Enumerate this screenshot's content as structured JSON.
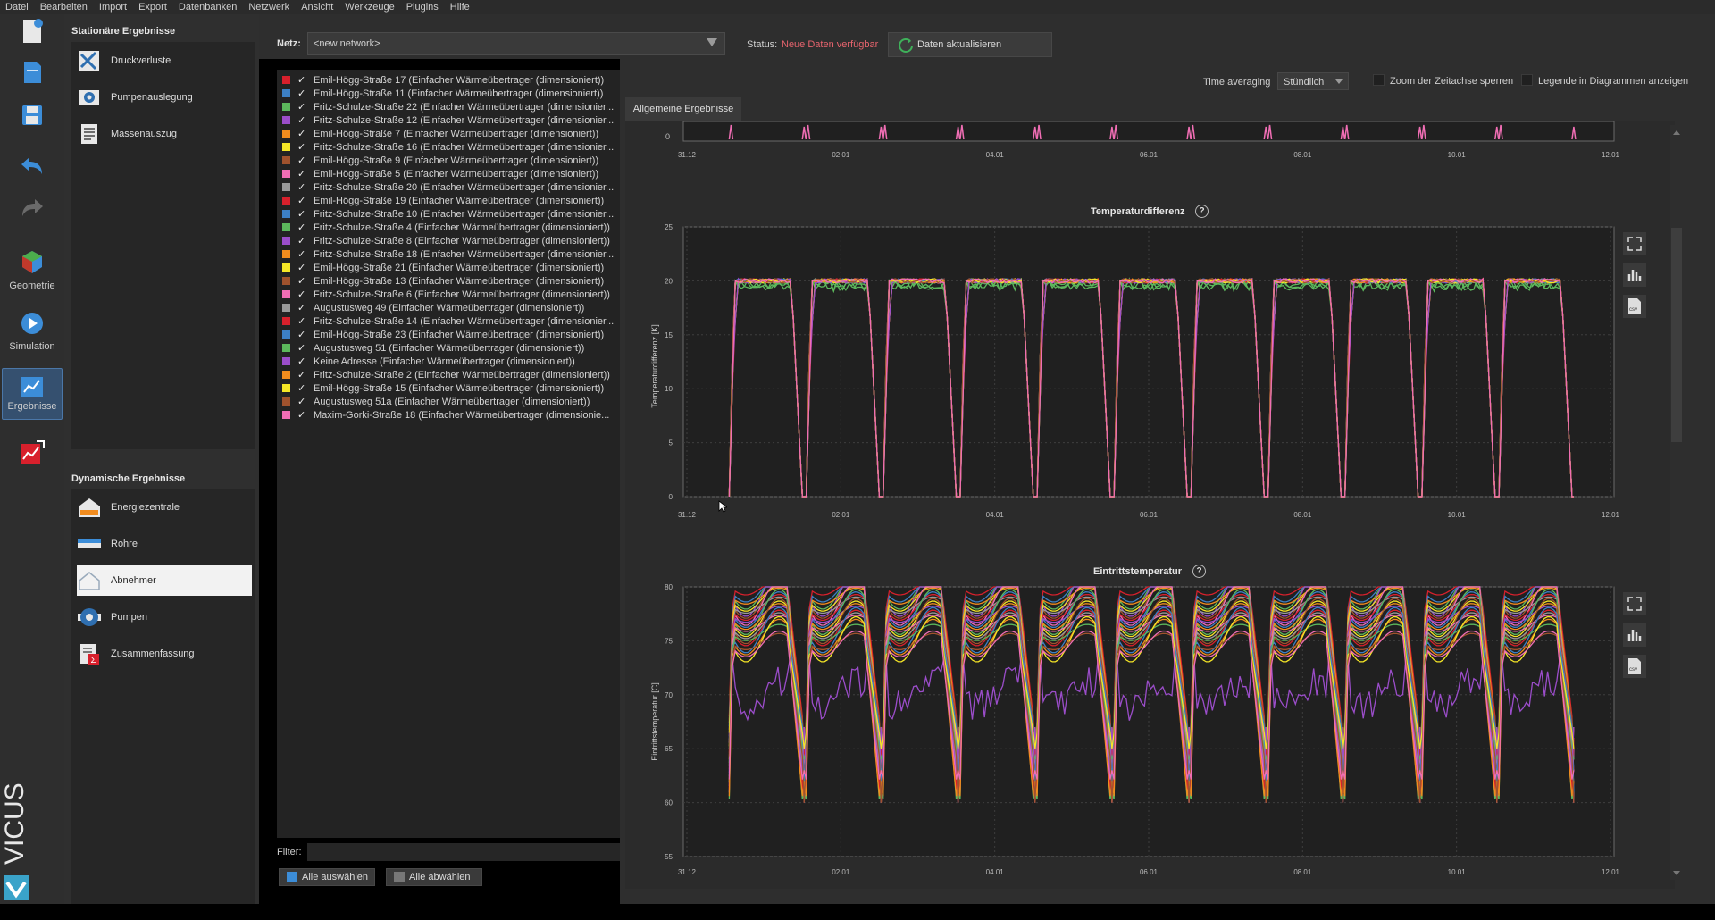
{
  "menu": [
    "Datei",
    "Bearbeiten",
    "Import",
    "Export",
    "Datenbanken",
    "Netzwerk",
    "Ansicht",
    "Werkzeuge",
    "Plugins",
    "Hilfe"
  ],
  "toolbar": {
    "geometry_label": "Geometrie",
    "simulation_label": "Simulation",
    "results_label": "Ergebnisse",
    "brand": "VICUS"
  },
  "nav": {
    "stationary_title": "Stationäre Ergebnisse",
    "stationary_items": [
      "Druckverluste",
      "Pumpenauslegung",
      "Massenauszug"
    ],
    "dynamic_title": "Dynamische Ergebnisse",
    "dynamic_items": [
      "Energiezentrale",
      "Rohre",
      "Abnehmer",
      "Pumpen",
      "Zusammenfassung"
    ]
  },
  "network": {
    "label": "Netz:",
    "value": "<new network>",
    "status_label": "Status:",
    "status_value": "Neue Daten verfügbar",
    "refresh_label": "Daten aktualisieren"
  },
  "consumers": [
    {
      "name": "Emil-Högg-Straße 17 (Einfacher Wärmeübertrager (dimensioniert))",
      "color": "#d8202c"
    },
    {
      "name": "Emil-Högg-Straße 11 (Einfacher Wärmeübertrager (dimensioniert))",
      "color": "#3c7fc4"
    },
    {
      "name": "Fritz-Schulze-Straße 22 (Einfacher Wärmeübertrager (dimensionier...",
      "color": "#5cb85c"
    },
    {
      "name": "Fritz-Schulze-Straße 12 (Einfacher Wärmeübertrager (dimensionier...",
      "color": "#9b4dca"
    },
    {
      "name": "Emil-Högg-Straße 7 (Einfacher Wärmeübertrager (dimensioniert))",
      "color": "#f28c1e"
    },
    {
      "name": "Fritz-Schulze-Straße 16 (Einfacher Wärmeübertrager (dimensionier...",
      "color": "#f5e626"
    },
    {
      "name": "Emil-Högg-Straße 9 (Einfacher Wärmeübertrager (dimensioniert))",
      "color": "#a0522d"
    },
    {
      "name": "Emil-Högg-Straße 5 (Einfacher Wärmeübertrager (dimensioniert))",
      "color": "#f06eb4"
    },
    {
      "name": "Fritz-Schulze-Straße 20 (Einfacher Wärmeübertrager (dimensionier...",
      "color": "#9a9a9a"
    },
    {
      "name": "Emil-Högg-Straße 19 (Einfacher Wärmeübertrager (dimensioniert))",
      "color": "#d8202c"
    },
    {
      "name": "Fritz-Schulze-Straße 10 (Einfacher Wärmeübertrager (dimensionier...",
      "color": "#3c7fc4"
    },
    {
      "name": "Fritz-Schulze-Straße 4 (Einfacher Wärmeübertrager (dimensioniert))",
      "color": "#5cb85c"
    },
    {
      "name": "Fritz-Schulze-Straße 8 (Einfacher Wärmeübertrager (dimensioniert))",
      "color": "#9b4dca"
    },
    {
      "name": "Fritz-Schulze-Straße 18 (Einfacher Wärmeübertrager (dimensionier...",
      "color": "#f28c1e"
    },
    {
      "name": "Emil-Högg-Straße 21 (Einfacher Wärmeübertrager (dimensioniert))",
      "color": "#f5e626"
    },
    {
      "name": "Emil-Högg-Straße 13 (Einfacher Wärmeübertrager (dimensioniert))",
      "color": "#a0522d"
    },
    {
      "name": "Fritz-Schulze-Straße 6 (Einfacher Wärmeübertrager (dimensioniert))",
      "color": "#f06eb4"
    },
    {
      "name": "Augustusweg 49 (Einfacher Wärmeübertrager (dimensioniert))",
      "color": "#9a9a9a"
    },
    {
      "name": "Fritz-Schulze-Straße 14 (Einfacher Wärmeübertrager (dimensionier...",
      "color": "#d8202c"
    },
    {
      "name": "Emil-Högg-Straße 23 (Einfacher Wärmeübertrager (dimensioniert))",
      "color": "#3c7fc4"
    },
    {
      "name": "Augustusweg 51 (Einfacher Wärmeübertrager (dimensioniert))",
      "color": "#5cb85c"
    },
    {
      "name": "Keine Adresse (Einfacher Wärmeübertrager (dimensioniert))",
      "color": "#9b4dca"
    },
    {
      "name": "Fritz-Schulze-Straße 2 (Einfacher Wärmeübertrager (dimensioniert))",
      "color": "#f28c1e"
    },
    {
      "name": "Emil-Högg-Straße 15 (Einfacher Wärmeübertrager (dimensioniert))",
      "color": "#f5e626"
    },
    {
      "name": "Augustusweg 51a (Einfacher Wärmeübertrager (dimensioniert))",
      "color": "#a0522d"
    },
    {
      "name": "Maxim-Gorki-Straße 18 (Einfacher Wärmeübertrager (dimensionie...",
      "color": "#f06eb4"
    }
  ],
  "list": {
    "check_mark": "✓",
    "filter_label": "Filter:",
    "filter_value": "",
    "select_all": "Alle auswählen",
    "deselect_all": "Alle abwählen"
  },
  "options": {
    "time_avg_label": "Time averaging",
    "time_avg_value": "Stündlich",
    "zoom_lock_label": "Zoom der Zeitachse sperren",
    "zoom_lock_checked": false,
    "legend_label": "Legende in Diagrammen anzeigen",
    "legend_checked": false
  },
  "tab_label": "Allgemeine Ergebnisse",
  "x_ticks": [
    "31.12",
    "02.01",
    "04.01",
    "06.01",
    "08.01",
    "10.01",
    "12.01"
  ],
  "chart_data": [
    {
      "type": "line",
      "title": "",
      "ylabel": "",
      "x_ticks": [
        "31.12",
        "02.01",
        "04.01",
        "06.01",
        "08.01",
        "10.01",
        "12.01"
      ],
      "y_ticks": [
        "0"
      ],
      "note": "partially visible chart above, values near 0 with small daily spikes"
    },
    {
      "type": "line",
      "title": "Temperaturdifferenz",
      "ylabel": "Temperaturdifferenz [K]",
      "ylim": [
        0,
        25
      ],
      "y_ticks": [
        "0",
        "5",
        "10",
        "15",
        "20",
        "25"
      ],
      "x_ticks": [
        "31.12",
        "02.01",
        "04.01",
        "06.01",
        "08.01",
        "10.01",
        "12.01"
      ],
      "days": 11,
      "plateau": 20,
      "trough": 0,
      "series_count": 26
    },
    {
      "type": "line",
      "title": "Eintrittstemperatur",
      "ylabel": "Eintrittstemperatur [C]",
      "ylim": [
        55,
        80
      ],
      "y_ticks": [
        "55",
        "60",
        "65",
        "70",
        "75",
        "80"
      ],
      "x_ticks": [
        "31.12",
        "02.01",
        "04.01",
        "06.01",
        "08.01",
        "10.01",
        "12.01"
      ],
      "days": 11,
      "plateau_range": [
        70,
        80
      ],
      "trough_range": [
        60,
        68
      ],
      "series_count": 26
    }
  ]
}
